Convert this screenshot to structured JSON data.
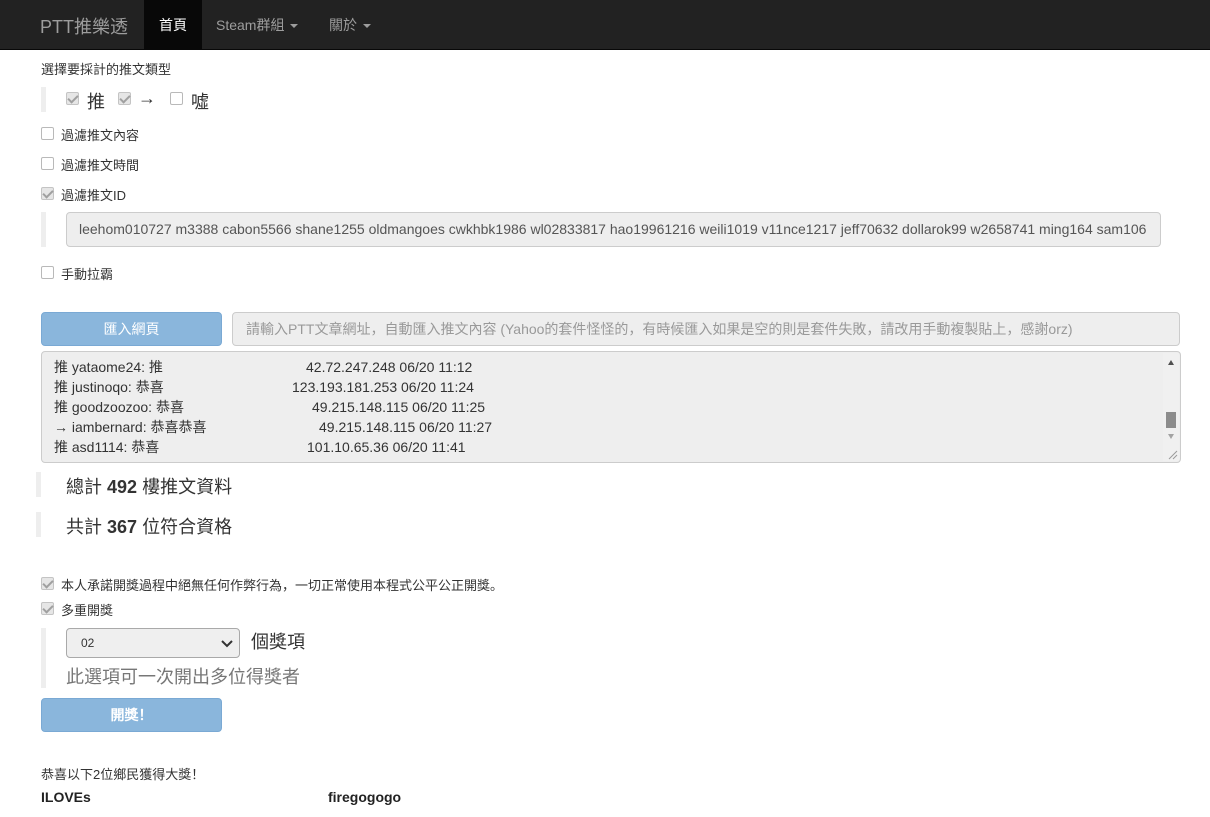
{
  "navbar": {
    "brand": "PTT推樂透",
    "items": [
      {
        "label": "首頁",
        "active": true
      },
      {
        "label": "Steam群組",
        "dropdown": true
      },
      {
        "label": "關於",
        "dropdown": true
      }
    ]
  },
  "push_types": {
    "heading": "選擇要採計的推文類型",
    "options": [
      {
        "label": "推",
        "checked": true
      },
      {
        "label": "→",
        "checked": true
      },
      {
        "label": "噓",
        "checked": false
      }
    ]
  },
  "filters": {
    "content": {
      "label": "過濾推文內容",
      "checked": false
    },
    "time": {
      "label": "過濾推文時間",
      "checked": false
    },
    "id": {
      "label": "過濾推文ID",
      "checked": true
    },
    "id_list": "leehom010727 m3388 cabon5566 shane1255 oldmangoes cwkhbk1986 wl02833817 hao19961216 weili1019 v11nce1217 jeff70632 dollarok99 w2658741 ming164 sam106",
    "manual": {
      "label": "手動拉霸",
      "checked": false
    }
  },
  "import": {
    "button_label": "匯入網頁",
    "url_placeholder": "請輸入PTT文章網址，自動匯入推文內容 (Yahoo的套件怪怪的，有時候匯入如果是空的則是套件失敗，請改用手動複製貼上，感謝orz)"
  },
  "log": [
    {
      "text": "推 yataome24: 推",
      "ip": "42.72.247.248 06/20 11:12"
    },
    {
      "text": "推 justinoqo: 恭喜",
      "ip": "123.193.181.253 06/20 11:24"
    },
    {
      "text": "推 goodzoozoo: 恭喜",
      "ip": "49.215.148.115 06/20 11:25"
    },
    {
      "text": "→ iambernard: 恭喜恭喜",
      "ip": "49.215.148.115 06/20 11:27"
    },
    {
      "text": "推 asd1114: 恭喜",
      "ip": "101.10.65.36 06/20 11:41"
    }
  ],
  "stats": {
    "total_prefix": "總計",
    "total_count": "492",
    "total_suffix": "樓推文資料",
    "qualified_prefix": "共計",
    "qualified_count": "367",
    "qualified_suffix": "位符合資格"
  },
  "draw": {
    "promise": {
      "label": "本人承諾開獎過程中絕無任何作弊行為，一切正常使用本程式公平公正開獎。",
      "checked": true
    },
    "multi": {
      "label": "多重開獎",
      "checked": true
    },
    "prize_count": "02",
    "prize_suffix": "個獎項",
    "hint": "此選項可一次開出多位得獎者",
    "button_label": "開獎！"
  },
  "result": {
    "heading": "恭喜以下2位鄉民獲得大獎！",
    "winners": [
      "ILOVEs",
      "firegogogo"
    ]
  },
  "colors": {
    "navbar_bg": "#222222",
    "nav_active_bg": "#080808",
    "button_bg": "#8ab6dc",
    "field_bg": "#eeeeee"
  }
}
